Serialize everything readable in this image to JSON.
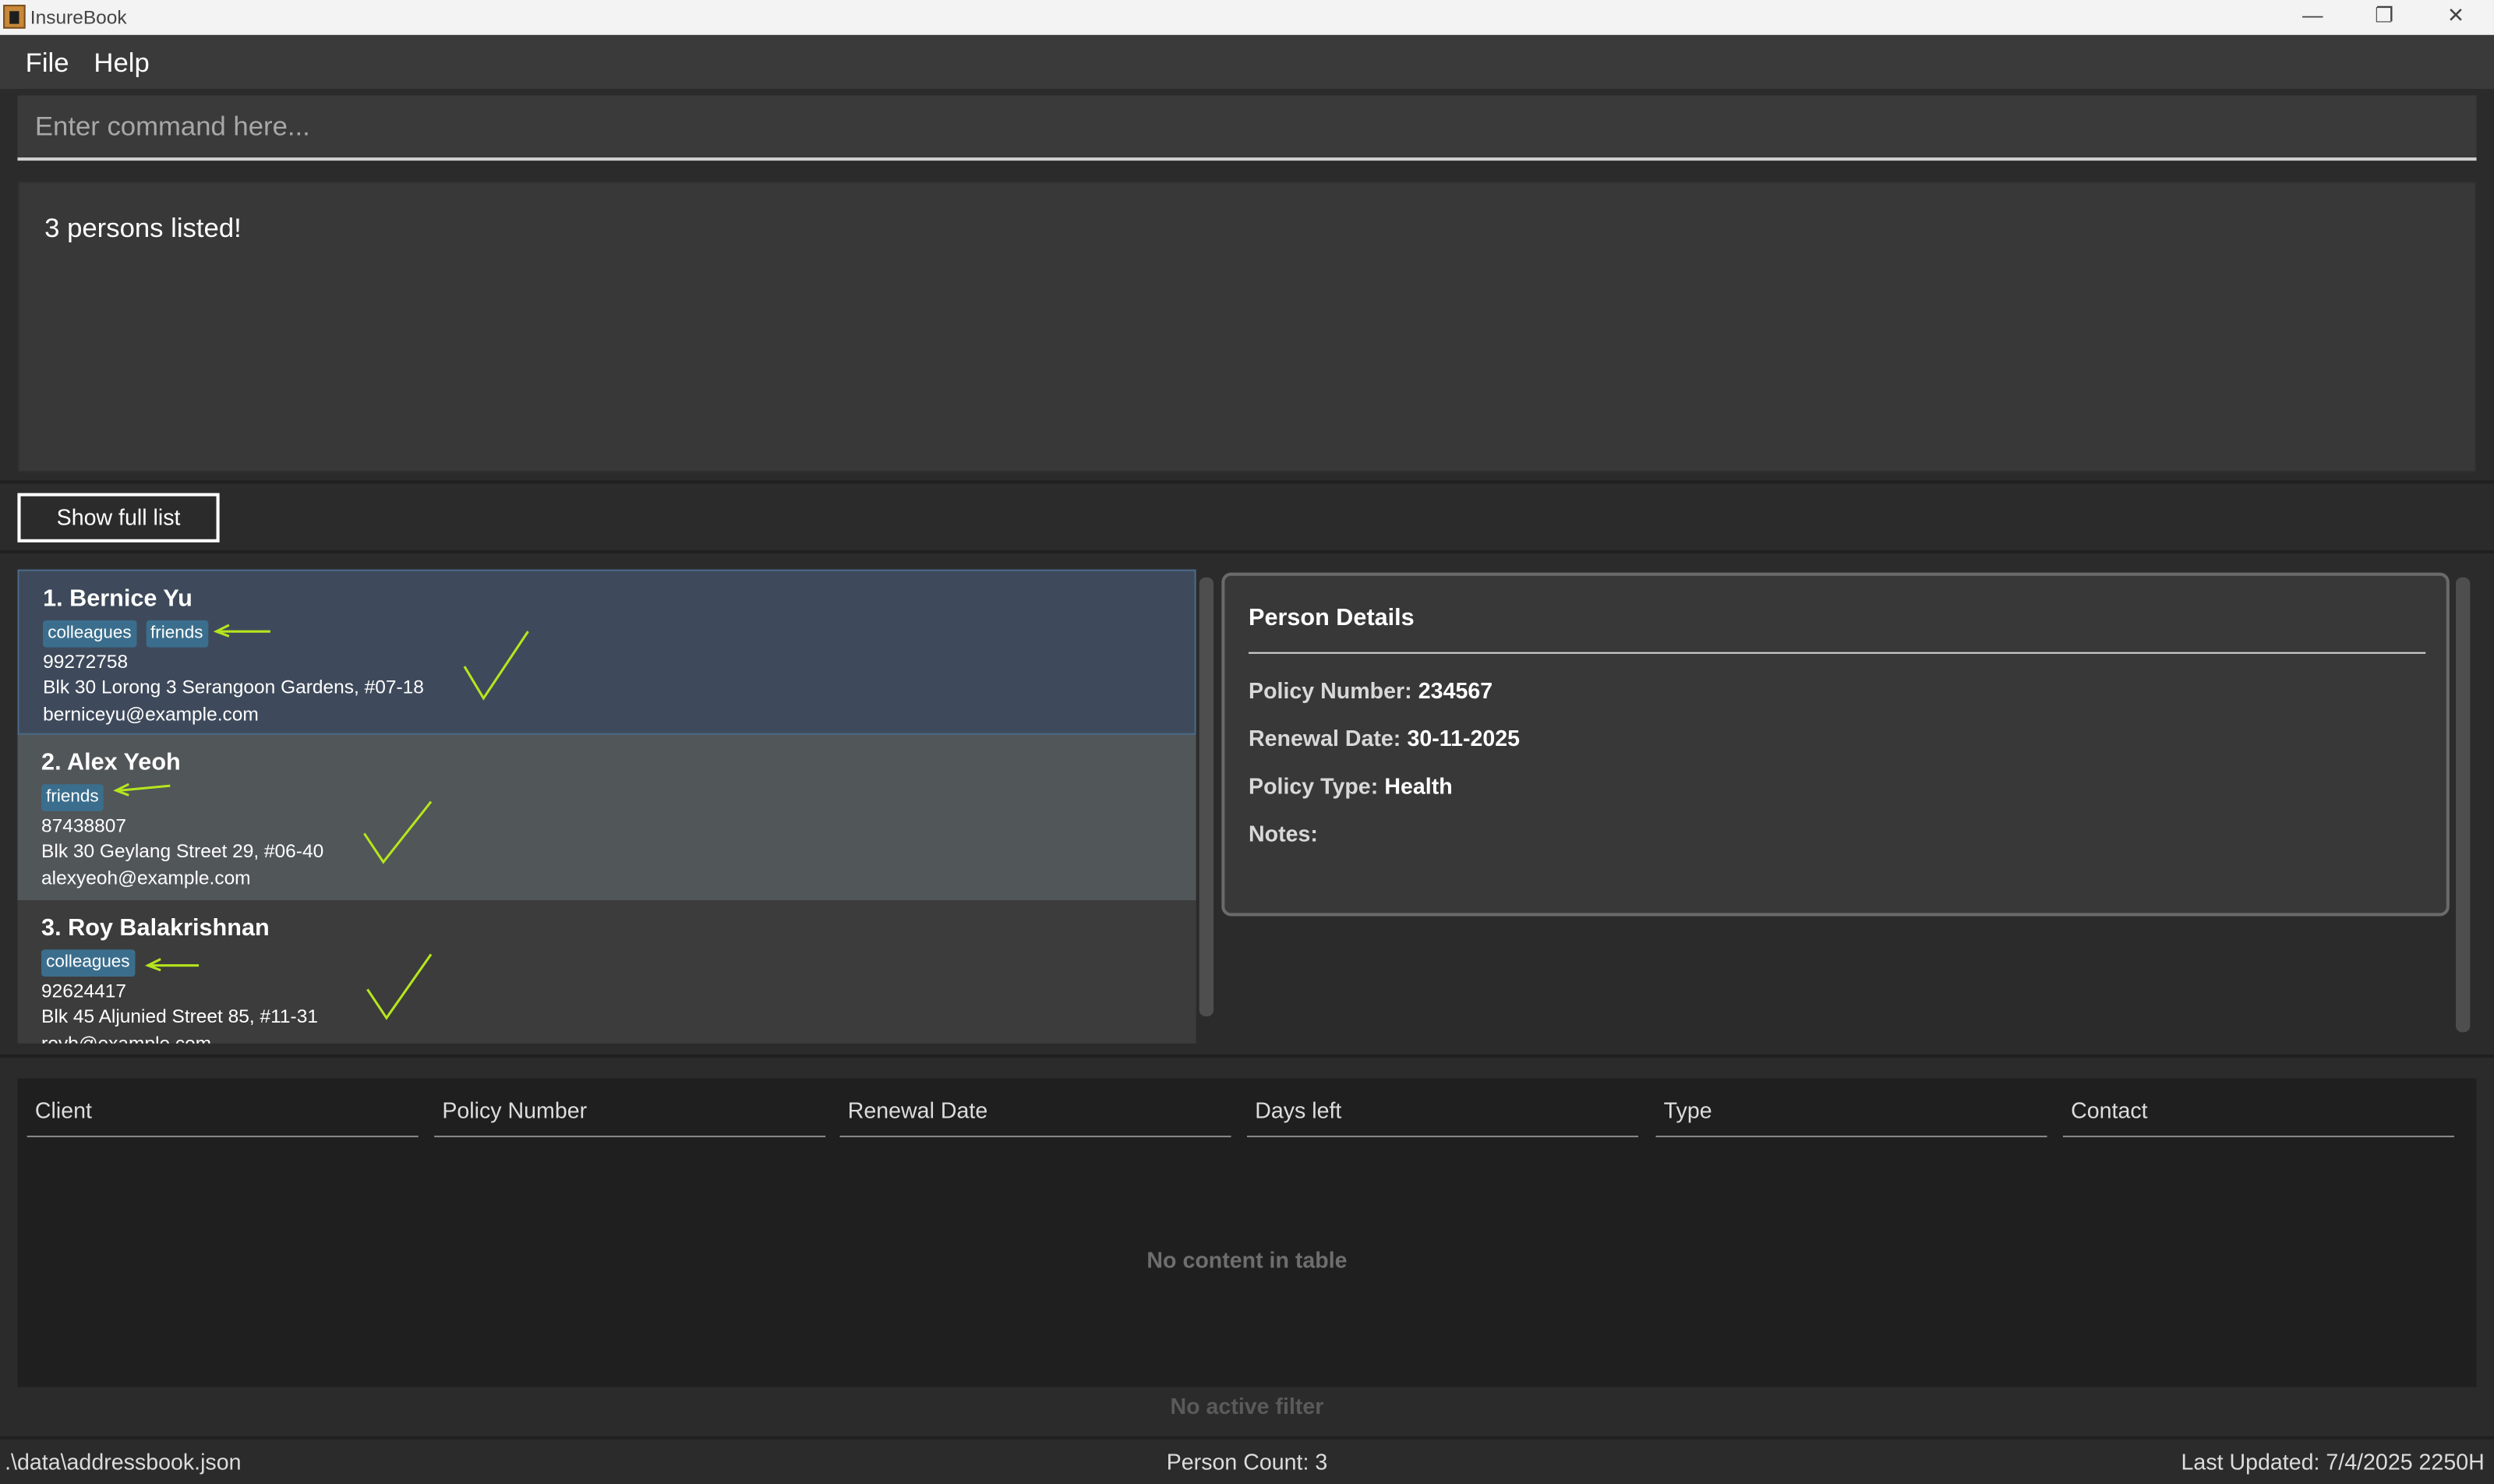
{
  "window": {
    "title": "InsureBook"
  },
  "menu": {
    "file": "File",
    "help": "Help"
  },
  "command": {
    "placeholder": "Enter command here..."
  },
  "result": {
    "text": "3 persons listed!"
  },
  "controls": {
    "show_full_list": "Show full list"
  },
  "persons": [
    {
      "name": "1. Bernice Yu",
      "tags": [
        "colleagues",
        "friends"
      ],
      "phone": "99272758",
      "address": "Blk 30 Lorong 3 Serangoon Gardens, #07-18",
      "email": "berniceyu@example.com",
      "selected": true
    },
    {
      "name": "2. Alex Yeoh",
      "tags": [
        "friends"
      ],
      "phone": "87438807",
      "address": "Blk 30 Geylang Street 29, #06-40",
      "email": "alexyeoh@example.com"
    },
    {
      "name": "3. Roy Balakrishnan",
      "tags": [
        "colleagues"
      ],
      "phone": "92624417",
      "address": "Blk 45 Aljunied Street 85, #11-31",
      "email": "royb@example.com"
    }
  ],
  "details": {
    "title": "Person Details",
    "policy_number_label": "Policy Number:",
    "policy_number": "234567",
    "renewal_date_label": "Renewal Date:",
    "renewal_date": "30-11-2025",
    "policy_type_label": "Policy Type:",
    "policy_type": "Health",
    "notes_label": "Notes:",
    "notes": ""
  },
  "table": {
    "columns": [
      "Client",
      "Policy Number",
      "Renewal Date",
      "Days left",
      "Type",
      "Contact"
    ],
    "empty_message": "No content in table",
    "filter_message": "No active filter"
  },
  "status": {
    "path": ".\\data\\addressbook.json",
    "count": "Person Count: 3",
    "updated": "Last Updated: 7/4/2025 2250H"
  },
  "colors": {
    "annotation": "#b5e61d",
    "tag": "#3b6e8d",
    "selected_card": "#3e4a5b"
  }
}
